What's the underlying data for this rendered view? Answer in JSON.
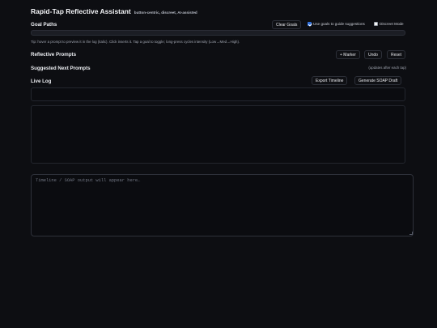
{
  "header": {
    "title": "Rapid-Tap Reflective Assistant",
    "subtitle": "button-centric, discreet, AI-assisted"
  },
  "goals": {
    "title": "Goal Paths",
    "clear_label": "Clear Goals",
    "use_goals_label": "Use goals to guide suggestions",
    "use_goals_checked": true,
    "discreet_label": "Discreet Mode",
    "discreet_checked": false,
    "tip": "Tip: hover a prompt to preview it in the log (italic). Click inserts it. Tap a goal to toggle; long-press cycles intensity (Low→Med→High)."
  },
  "prompts": {
    "title": "Reflective Prompts",
    "marker_label": "+ Marker",
    "undo_label": "Undo",
    "reset_label": "Reset"
  },
  "suggested": {
    "title": "Suggested Next Prompts",
    "hint": "(updates after each tap)"
  },
  "live_log": {
    "title": "Live Log",
    "export_label": "Export Timeline",
    "soap_label": "Generate SOAP Draft"
  },
  "output": {
    "placeholder": "Timeline / SOAP output will appear here…"
  }
}
